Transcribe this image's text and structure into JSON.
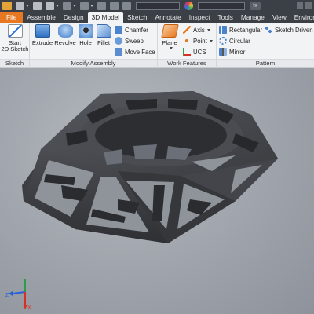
{
  "tabs": [
    "File",
    "Assemble",
    "Design",
    "3D Model",
    "Sketch",
    "Annotate",
    "Inspect",
    "Tools",
    "Manage",
    "View",
    "Environmen"
  ],
  "active_tab": "3D Model",
  "ribbon": {
    "sketch": {
      "title": "Sketch",
      "start_2d_sketch": "Start\n2D Sketch"
    },
    "modify_assembly": {
      "title": "Modify Assembly",
      "extrude": "Extrude",
      "revolve": "Revolve",
      "hole": "Hole",
      "fillet": "Fillet",
      "chamfer": "Chamfer",
      "sweep": "Sweep",
      "move_face": "Move Face"
    },
    "work_features": {
      "title": "Work Features",
      "plane": "Plane",
      "axis": "Axis",
      "point": "Point",
      "ucs": "UCS"
    },
    "pattern": {
      "title": "Pattern",
      "rectangular": "Rectangular",
      "circular": "Circular",
      "mirror": "Mirror",
      "sketch_driven": "Sketch Driven"
    }
  },
  "triad": {
    "x_label": "X",
    "z_label": "Z",
    "x_color": "#d93025",
    "y_color": "#2e9e44",
    "z_color": "#2a5fd6"
  },
  "colors": {
    "file_tab": "#e87722",
    "title_bar": "#3b3f46",
    "ribbon_bg": "#f2f3f5",
    "model": "#3f4145"
  }
}
